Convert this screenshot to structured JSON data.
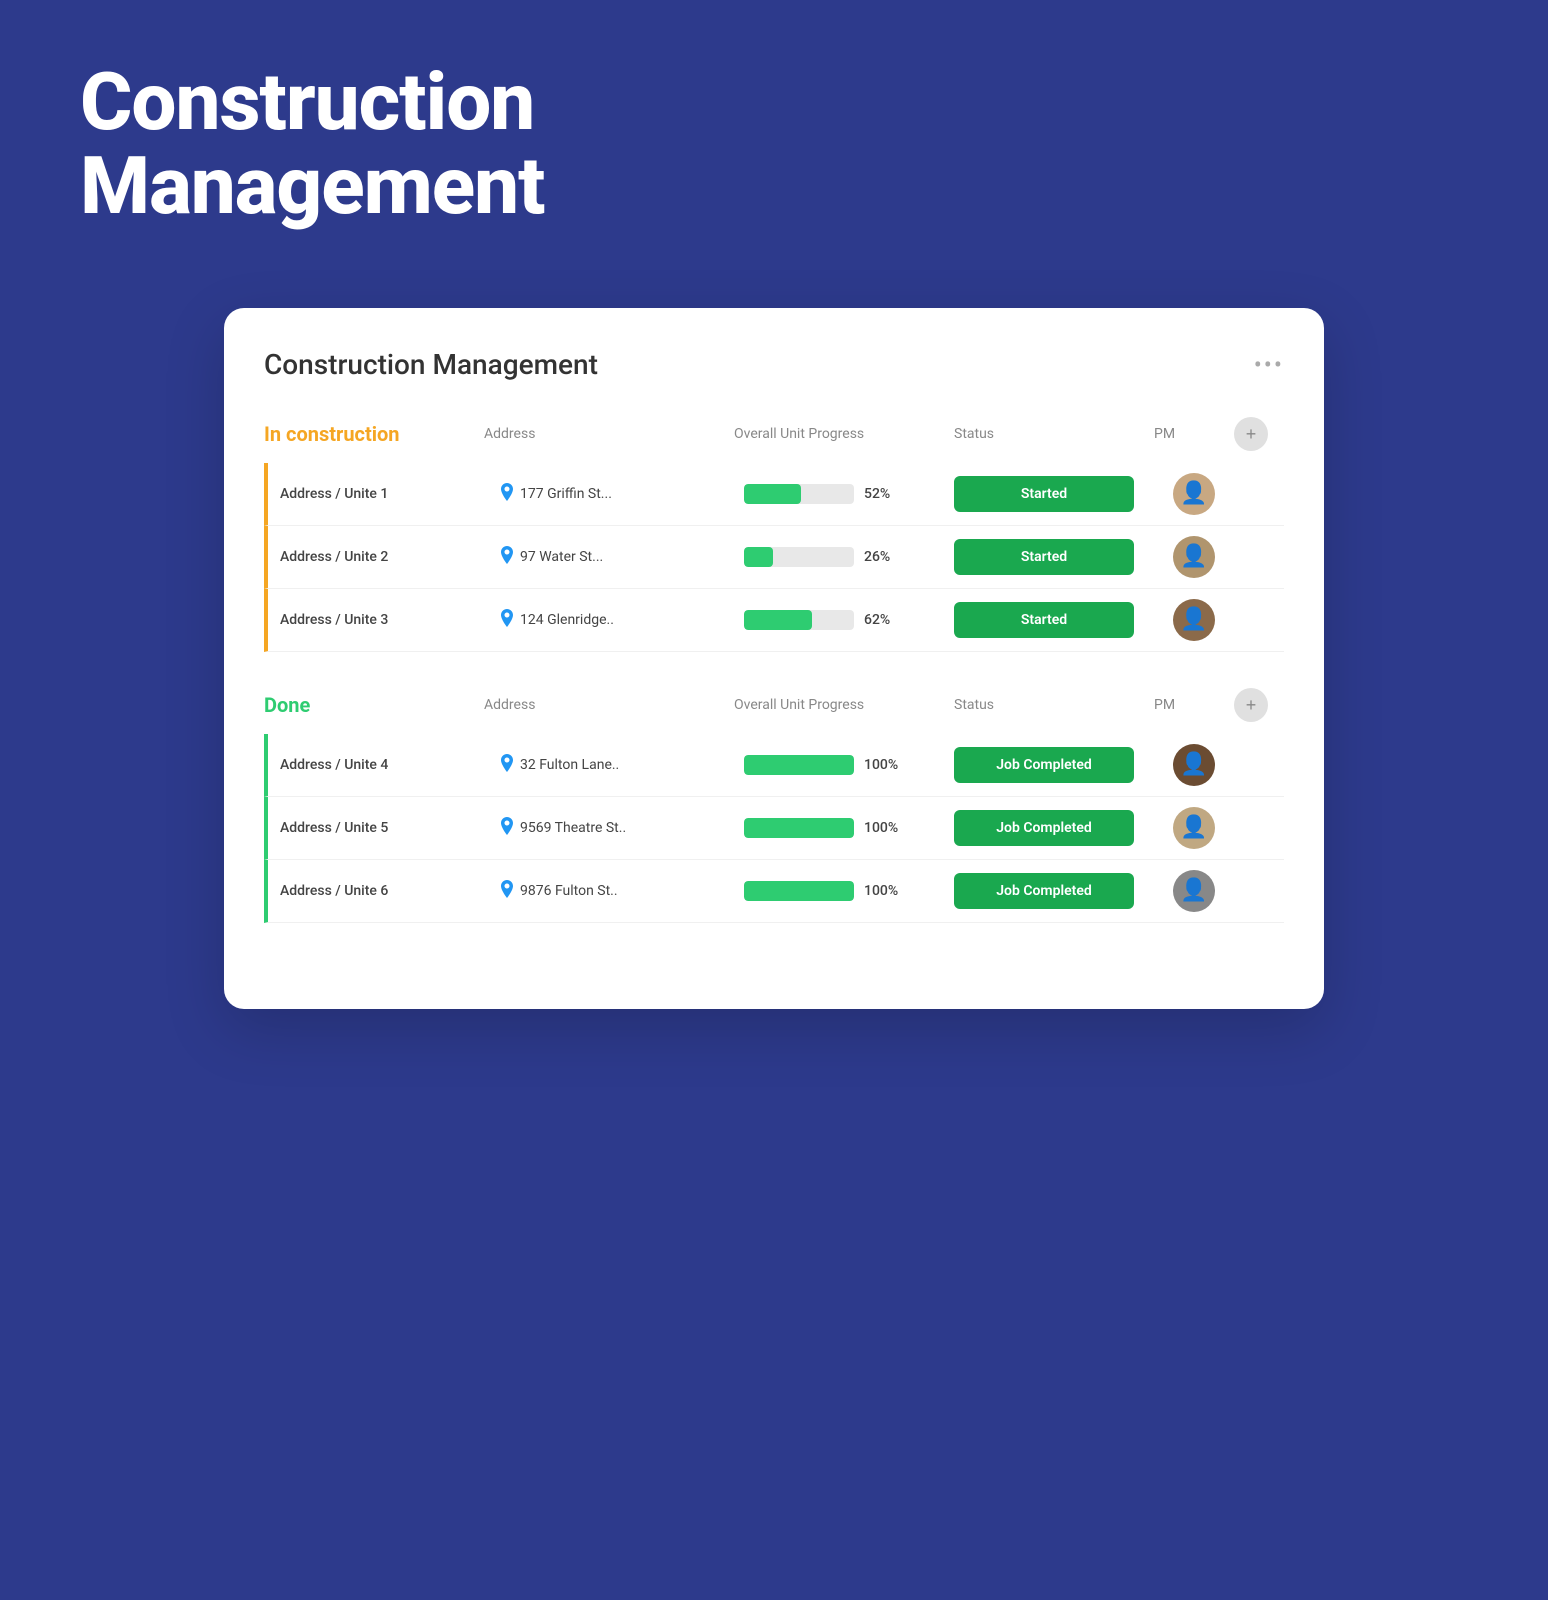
{
  "hero": {
    "title_line1": "Construction",
    "title_line2": "Management"
  },
  "card": {
    "title": "Construction Management",
    "more_label": "•••",
    "sections": [
      {
        "id": "in-construction",
        "title": "In construction",
        "color": "orange",
        "col_name": "Address",
        "col_progress": "Overall Unit Progress",
        "col_status": "Status",
        "col_pm": "PM",
        "rows": [
          {
            "name": "Address / Unite 1",
            "address": "177 Griffin St...",
            "progress": 52,
            "status": "Started",
            "avatar": "👨"
          },
          {
            "name": "Address / Unite 2",
            "address": "97  Water St...",
            "progress": 26,
            "status": "Started",
            "avatar": "👨"
          },
          {
            "name": "Address / Unite 3",
            "address": "124 Glenridge..",
            "progress": 62,
            "status": "Started",
            "avatar": "🧔"
          }
        ]
      },
      {
        "id": "done",
        "title": "Done",
        "color": "green",
        "col_name": "Address",
        "col_progress": "Overall Unit Progress",
        "col_status": "Status",
        "col_pm": "PM",
        "rows": [
          {
            "name": "Address / Unite 4",
            "address": "32 Fulton Lane..",
            "progress": 100,
            "status": "Job Completed",
            "avatar": "👨"
          },
          {
            "name": "Address / Unite 5",
            "address": "9569 Theatre St..",
            "progress": 100,
            "status": "Job Completed",
            "avatar": "👨"
          },
          {
            "name": "Address / Unite 6",
            "address": "9876 Fulton St..",
            "progress": 100,
            "status": "Job Completed",
            "avatar": "🕶️"
          }
        ]
      }
    ]
  }
}
